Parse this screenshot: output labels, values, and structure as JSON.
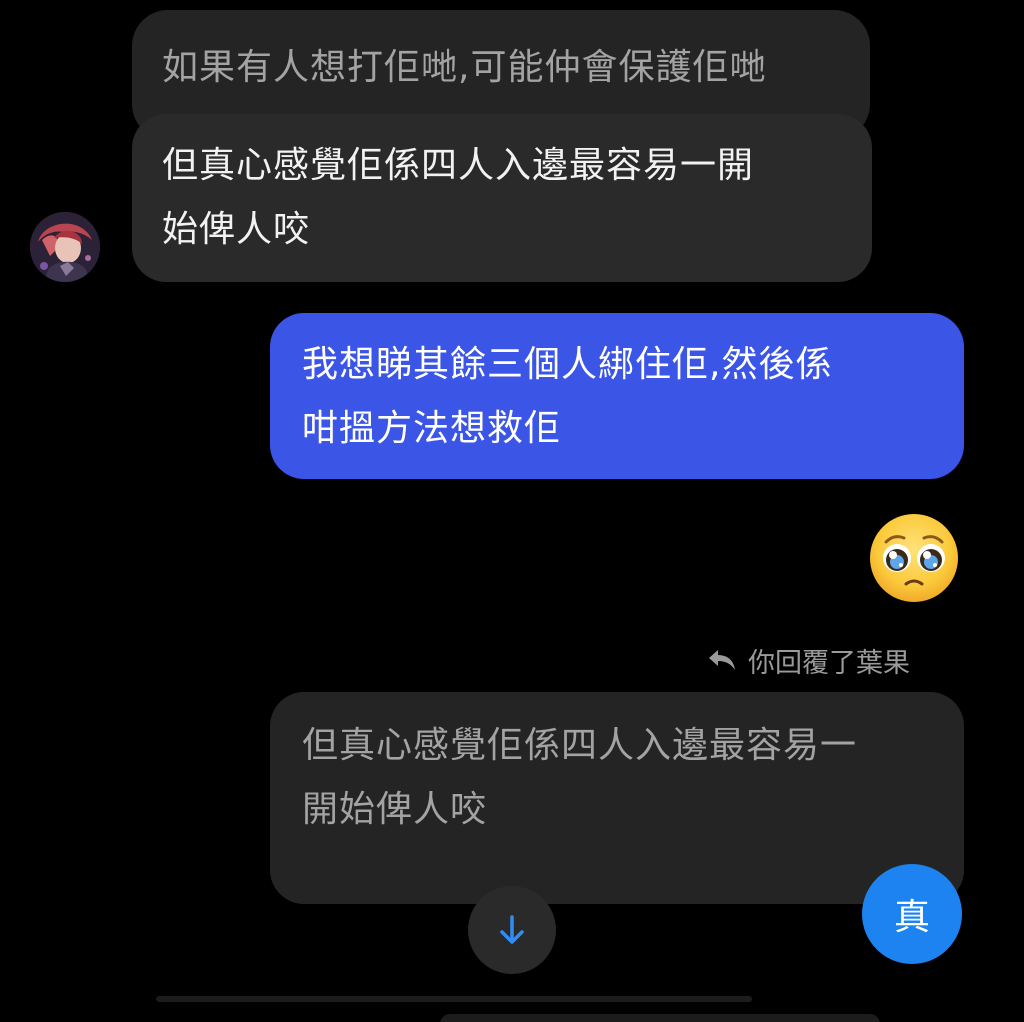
{
  "messages": {
    "previous_incoming": "如果有人想打佢哋,可能仲會保護佢哋",
    "incoming": "但真心感覺佢係四人入邊最容易一開\n始俾人咬",
    "outgoing": "我想睇其餘三個人綁住佢,然後係\n咁搵方法想救佢",
    "emoji": "🥺"
  },
  "reply": {
    "label": "你回覆了葉果",
    "quoted_text": "但真心感覺佢係四人入邊最容易一\n開始俾人咬",
    "reply_text": "真"
  },
  "icons": {
    "reply": "reply-arrow-icon",
    "scroll_down": "arrow-down-icon",
    "avatar": "avatar-image",
    "emoji": "pleading-face-icon"
  },
  "colors": {
    "background": "#000000",
    "incoming_bubble": "#2a2a2a",
    "outgoing_bubble": "#3b55e6",
    "reply_bubble": "#1d83f0",
    "scroll_arrow": "#2f8ef5"
  }
}
